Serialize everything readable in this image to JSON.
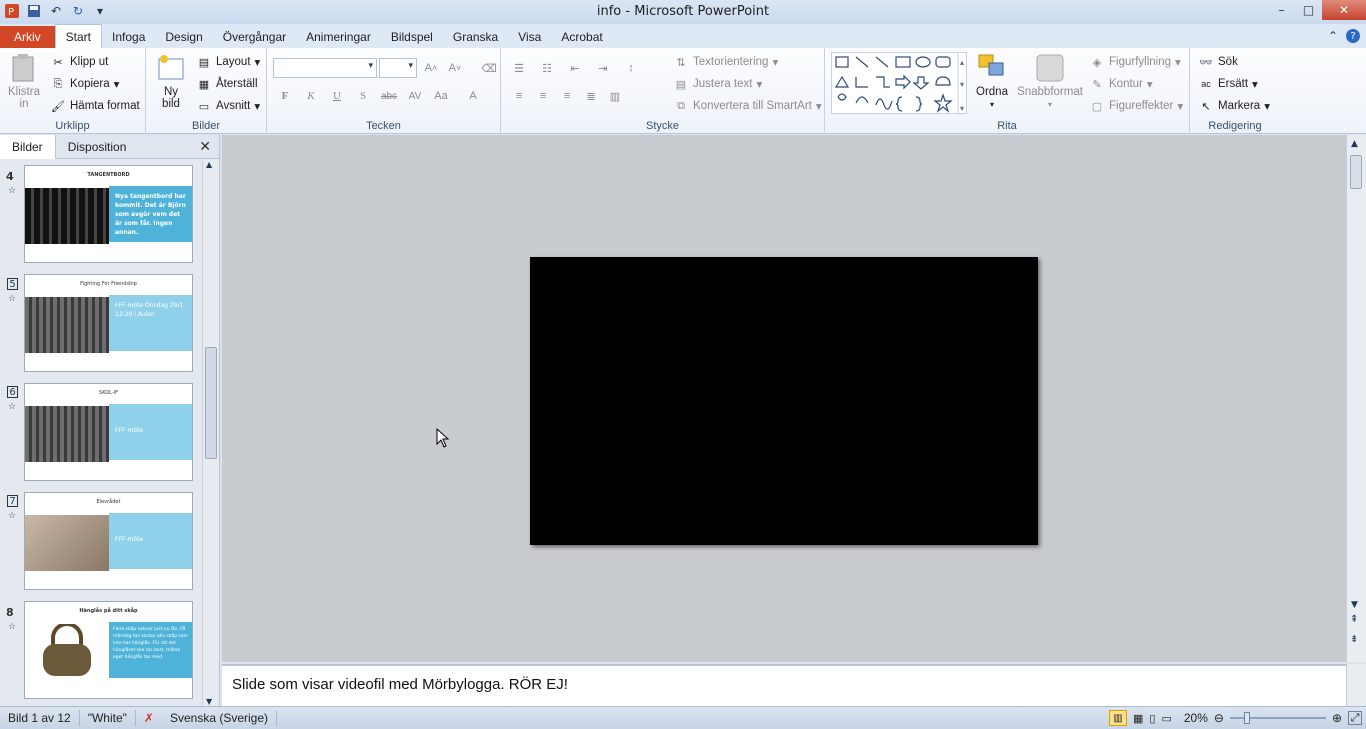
{
  "window": {
    "doc": "info",
    "sep": " - ",
    "app": "Microsoft PowerPoint",
    "minimize": "–",
    "maximize": "□",
    "close": "✕"
  },
  "tabs": {
    "file": "Arkiv",
    "items": [
      "Start",
      "Infoga",
      "Design",
      "Övergångar",
      "Animeringar",
      "Bildspel",
      "Granska",
      "Visa",
      "Acrobat"
    ]
  },
  "ribbon": {
    "urklipp": {
      "label": "Urklipp",
      "paste": "Klistra in",
      "cut": "Klipp ut",
      "copy": "Kopiera",
      "format": "Hämta format"
    },
    "bilder": {
      "label": "Bilder",
      "new_slide": "Ny bild",
      "layout": "Layout",
      "reset": "Återställ",
      "section": "Avsnitt"
    },
    "tecken": {
      "label": "Tecken",
      "bold": "F",
      "italic": "K",
      "underline": "U",
      "strike": "S",
      "abc": "abc",
      "av": "AV",
      "aa": "Aa",
      "fontcolor": "A"
    },
    "stycke": {
      "label": "Stycke",
      "textdir": "Textorientering",
      "align": "Justera text",
      "smartart": "Konvertera till SmartArt"
    },
    "rita": {
      "label": "Rita",
      "arrange": "Ordna",
      "quickstyles": "Snabbformat",
      "fill": "Figurfyllning",
      "outline": "Kontur",
      "effects": "Figureffekter"
    },
    "redigering": {
      "label": "Redigering",
      "find": "Sök",
      "replace": "Ersätt",
      "select": "Markera"
    }
  },
  "panel": {
    "tab_slides": "Bilder",
    "tab_outline": "Disposition",
    "close": "✕"
  },
  "thumbnails": [
    {
      "num": "4",
      "title": "TANGENTBORD",
      "text": "Nya tangentbord har kommit. Det är Björn som avgör vem det är som får. Ingen annan.",
      "pic": "#2a2a2a"
    },
    {
      "num": "",
      "title": "Fighting For Friendship",
      "text": "FFF-möte Onsdag 29/1 13:20 i Aulan",
      "pic": "#555"
    },
    {
      "num": "",
      "title": "SKOL-IF",
      "text": "FFF-möte",
      "pic": "#555"
    },
    {
      "num": "",
      "title": "Elevrådet",
      "text": "FFF-möte",
      "pic": "#b8a89a"
    },
    {
      "num": "8",
      "title": "Hänglås på ditt skåp",
      "text": "Flera skåp saknar just nu lås. På måndag tas skolan alla skåp som inte har hänglås. För att det hänglåset ska tas bort, måste eget hänglås tas med.",
      "pic": "#6b5a3a"
    }
  ],
  "notes": "Slide som visar videofil med Mörbylogga. RÖR EJ!",
  "status": {
    "slide": "Bild 1 av 12",
    "theme": "\"White\"",
    "language": "Svenska (Sverige)",
    "zoom": "20%"
  }
}
